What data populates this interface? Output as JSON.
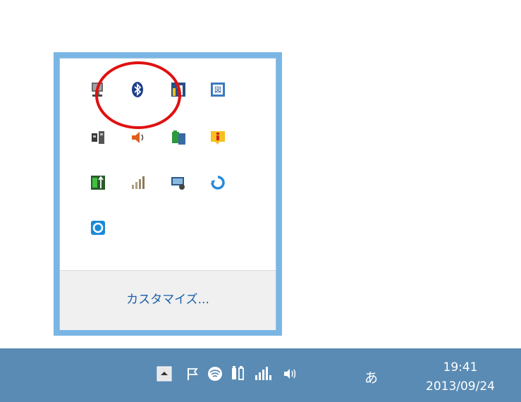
{
  "popup": {
    "customize_label": "カスタマイズ...",
    "icons": [
      {
        "name": "computer-icon"
      },
      {
        "name": "bluetooth-icon"
      },
      {
        "name": "settings-tool-icon"
      },
      {
        "name": "japanese-ime-dictionary-icon"
      },
      {
        "name": "network-plug-icon"
      },
      {
        "name": "speaker-volume-icon"
      },
      {
        "name": "battery-tool-icon"
      },
      {
        "name": "info-notification-icon"
      },
      {
        "name": "usb-device-icon"
      },
      {
        "name": "signal-strength-icon"
      },
      {
        "name": "display-settings-icon"
      },
      {
        "name": "sync-refresh-icon"
      },
      {
        "name": "app-circle-icon"
      }
    ]
  },
  "highlight": {
    "color": "#e01010"
  },
  "taskbar": {
    "icons": [
      {
        "name": "show-hidden-icons-icon"
      },
      {
        "name": "action-center-flag-icon"
      },
      {
        "name": "wifi-icon"
      },
      {
        "name": "battery-icon"
      },
      {
        "name": "mobile-signal-icon"
      },
      {
        "name": "volume-icon"
      }
    ],
    "ime_label": "あ",
    "clock": {
      "time": "19:41",
      "date": "2013/09/24"
    }
  },
  "colors": {
    "taskbar_bg": "#5a8bb4",
    "popup_border": "#7ab6e4",
    "link": "#1a5fa8"
  }
}
